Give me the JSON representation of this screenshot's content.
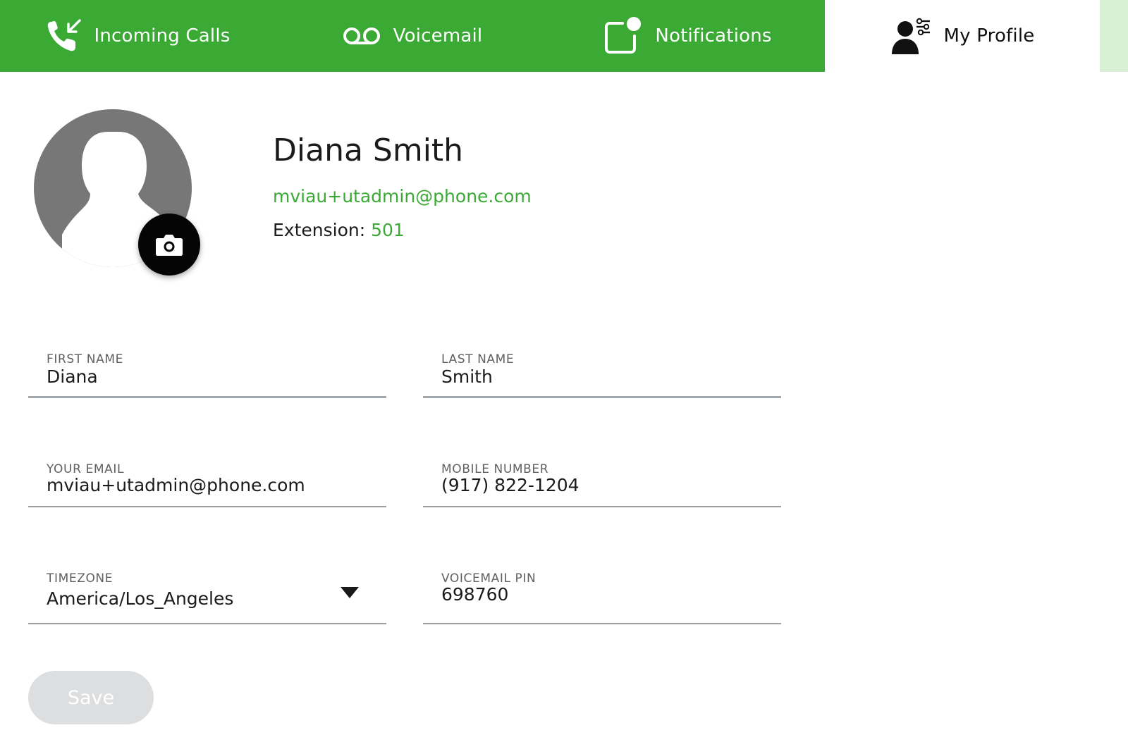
{
  "nav": {
    "tabs": [
      {
        "label": "Incoming Calls",
        "icon": "incoming-call-icon",
        "active": false
      },
      {
        "label": "Voicemail",
        "icon": "voicemail-icon",
        "active": false
      },
      {
        "label": "Notifications",
        "icon": "notification-icon",
        "active": false
      },
      {
        "label": "My Profile",
        "icon": "profile-settings-icon",
        "active": true
      }
    ]
  },
  "profile": {
    "name": "Diana Smith",
    "email": "mviau+utadmin@phone.com",
    "extension_label": "Extension: ",
    "extension": "501"
  },
  "form": {
    "first_name": {
      "label": "FIRST NAME",
      "value": "Diana"
    },
    "last_name": {
      "label": "LAST NAME",
      "value": "Smith"
    },
    "email": {
      "label": "YOUR EMAIL",
      "value": "mviau+utadmin@phone.com"
    },
    "mobile": {
      "label": "MOBILE NUMBER",
      "value": "(917) 822-1204"
    },
    "timezone": {
      "label": "TIMEZONE",
      "value": "America/Los_Angeles"
    },
    "voicemail_pin": {
      "label": "VOICEMAIL PIN",
      "value": "698760"
    },
    "save_label": "Save"
  },
  "colors": {
    "brand_green": "#3aaa35",
    "light_green": "#d9f0d6",
    "avatar_gray": "#777777",
    "disabled_button": "#dcdee0"
  }
}
